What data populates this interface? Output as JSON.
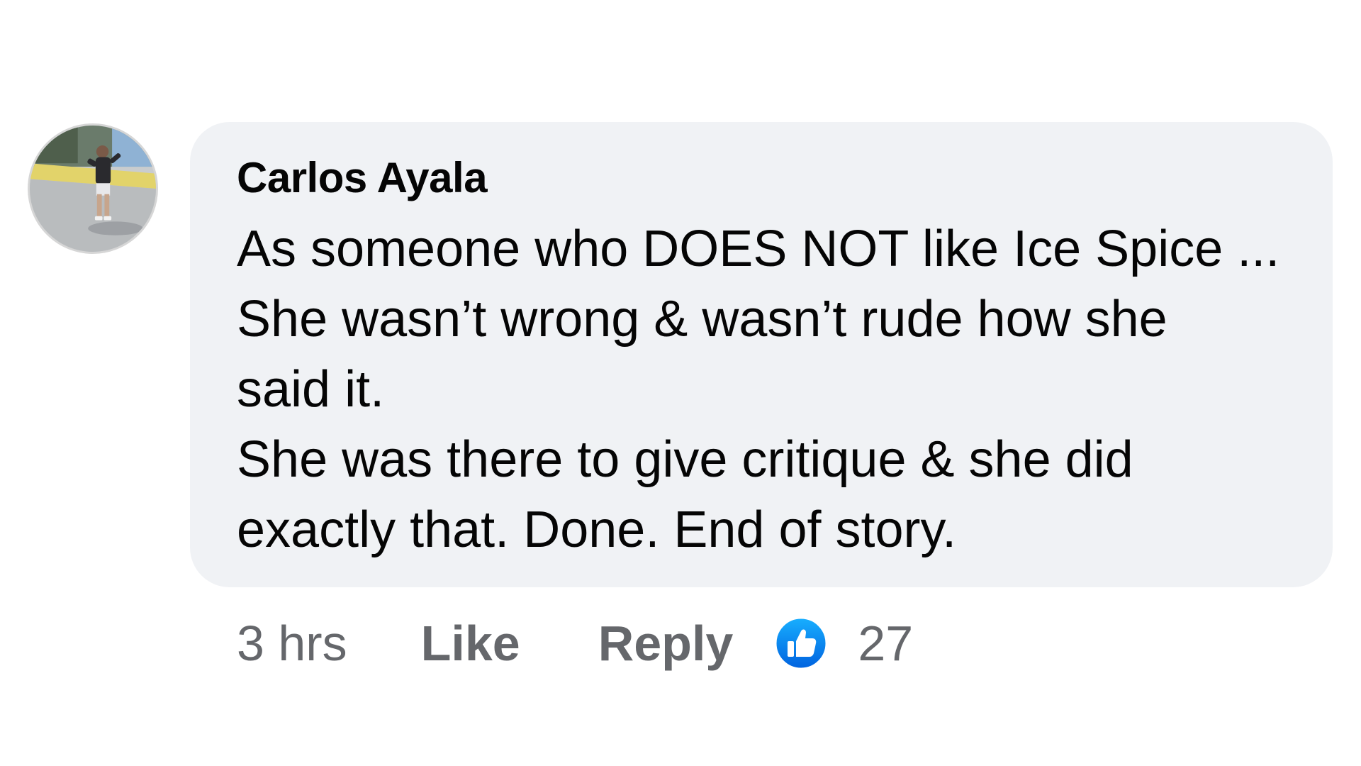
{
  "comment": {
    "author": "Carlos Ayala",
    "lines": [
      "As someone who DOES NOT like Ice Spice ...",
      "She wasn’t wrong & wasn’t rude how she",
      "said it.",
      "She was there to give critique & she did",
      "exactly that. Done. End of story."
    ],
    "time": "3 hrs",
    "like_label": "Like",
    "reply_label": "Reply",
    "reaction_icon": "thumbs-up-icon",
    "reaction_count": "27"
  },
  "colors": {
    "bubble_bg": "#f0f2f5",
    "text": "#050505",
    "secondary_text": "#65676b",
    "like_blue": "#1877f2"
  }
}
